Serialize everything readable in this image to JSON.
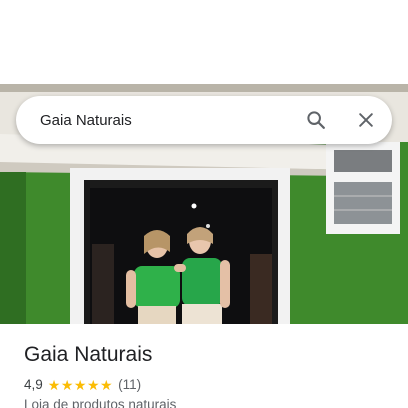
{
  "search": {
    "value": "Gaia Naturais",
    "search_icon": "search-icon",
    "close_icon": "close-icon"
  },
  "place": {
    "name": "Gaia Naturais",
    "rating": "4,9",
    "rating_stars": 5,
    "reviews_count": "(11)",
    "category": "Loja de produtos naturais"
  },
  "colors": {
    "star": "#fbbc04",
    "title": "#202124",
    "secondary": "#5f6368",
    "wall_green": "#3f8f2e"
  }
}
